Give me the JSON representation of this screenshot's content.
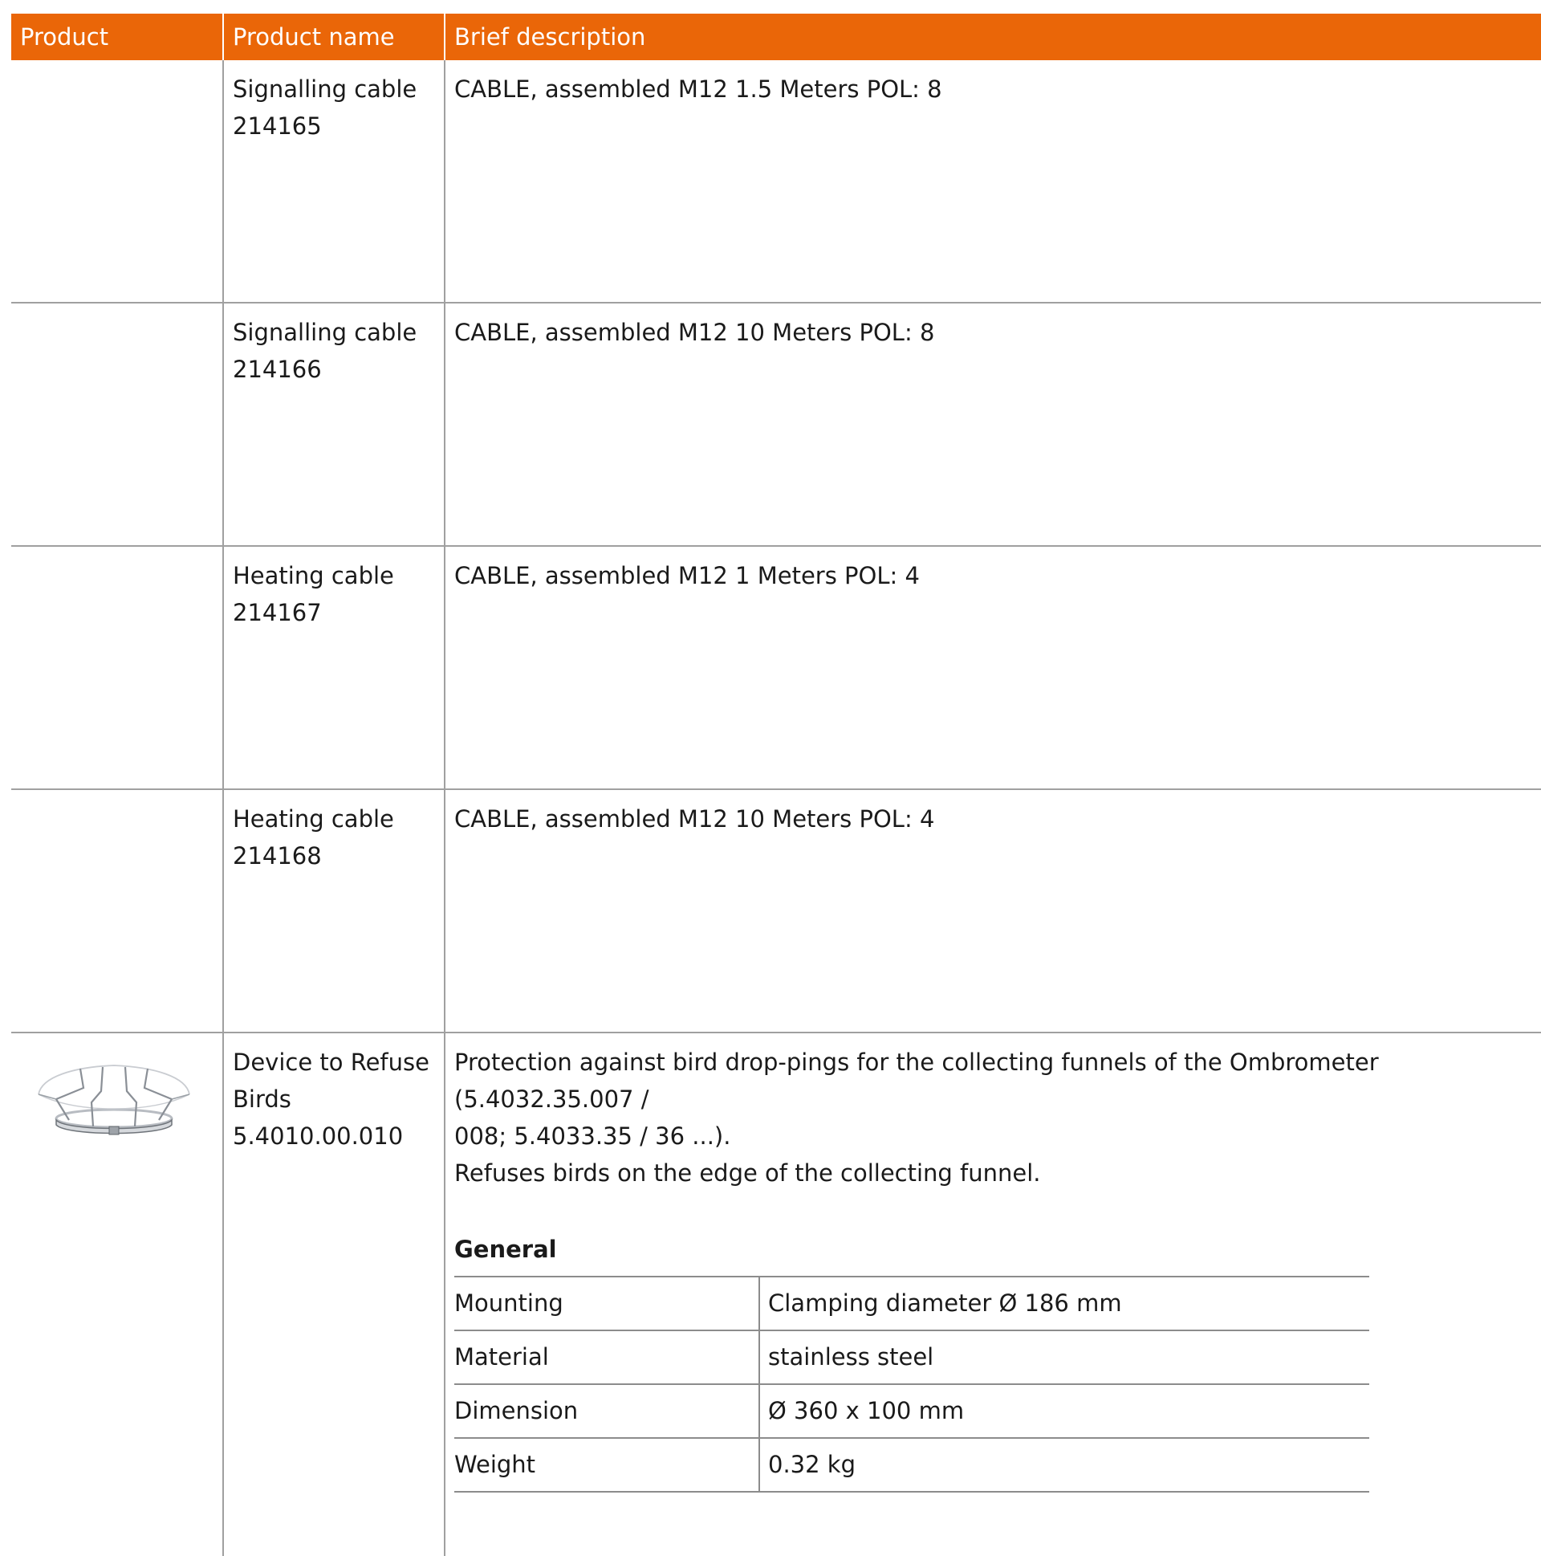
{
  "header": {
    "col_product": "Product",
    "col_name": "Product name",
    "col_desc": "Brief description"
  },
  "rows": [
    {
      "name_line1": "Signalling cable",
      "name_line2": "214165",
      "desc": "CABLE, assembled M12 1.5 Meters POL: 8"
    },
    {
      "name_line1": "Signalling cable",
      "name_line2": "214166",
      "desc": "CABLE, assembled M12 10 Meters POL: 8"
    },
    {
      "name_line1": "Heating cable",
      "name_line2": "214167",
      "desc": "CABLE, assembled M12 1 Meters POL: 4"
    },
    {
      "name_line1": "Heating cable",
      "name_line2": "214168",
      "desc": "CABLE, assembled M12 10 Meters POL: 4"
    },
    {
      "name_line1": "Device to Refuse",
      "name_line2": "Birds",
      "name_line3": "5.4010.00.010",
      "desc_line1": "Protection against bird drop-pings for the collecting funnels of the Ombrometer (5.4032.35.007 /",
      "desc_line2": "008; 5.4033.35 / 36 ...).",
      "desc_line3": "Refuses birds on the edge of the collecting funnel.",
      "spec": {
        "section": "General",
        "items": [
          {
            "key": "Mounting",
            "value": "Clamping diameter Ø 186 mm"
          },
          {
            "key": "Material",
            "value": "stainless steel"
          },
          {
            "key": "Dimension",
            "value": "Ø 360 x 100 mm"
          },
          {
            "key": "Weight",
            "value": "0.32 kg"
          }
        ]
      }
    }
  ],
  "colors": {
    "header_bg": "#ea6608",
    "header_text": "#ffffff",
    "grid": "#a0a0a0"
  }
}
